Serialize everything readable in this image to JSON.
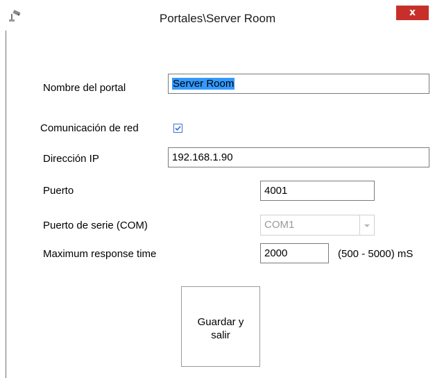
{
  "window": {
    "title": "Portales\\Server Room",
    "close_label": "x",
    "icon": "camera-icon"
  },
  "form": {
    "portal_name_label": "Nombre del portal",
    "portal_name_value": "Server Room",
    "network_comm_label": "Comunicación de red",
    "network_comm_checked": true,
    "ip_label": "Dirección IP",
    "ip_value": "192.168.1.90",
    "port_label": "Puerto",
    "port_value": "4001",
    "serial_port_label": "Puerto de serie (COM)",
    "serial_port_value": "COM1",
    "response_time_label": "Maximum response time",
    "response_time_value": "2000",
    "response_time_range": "(500 - 5000) mS"
  },
  "actions": {
    "save_line1": "Guardar y",
    "save_line2": "salir"
  },
  "colors": {
    "close_bg": "#c7302a",
    "selection": "#3399ff",
    "checkbox_border": "#3a72c8"
  }
}
